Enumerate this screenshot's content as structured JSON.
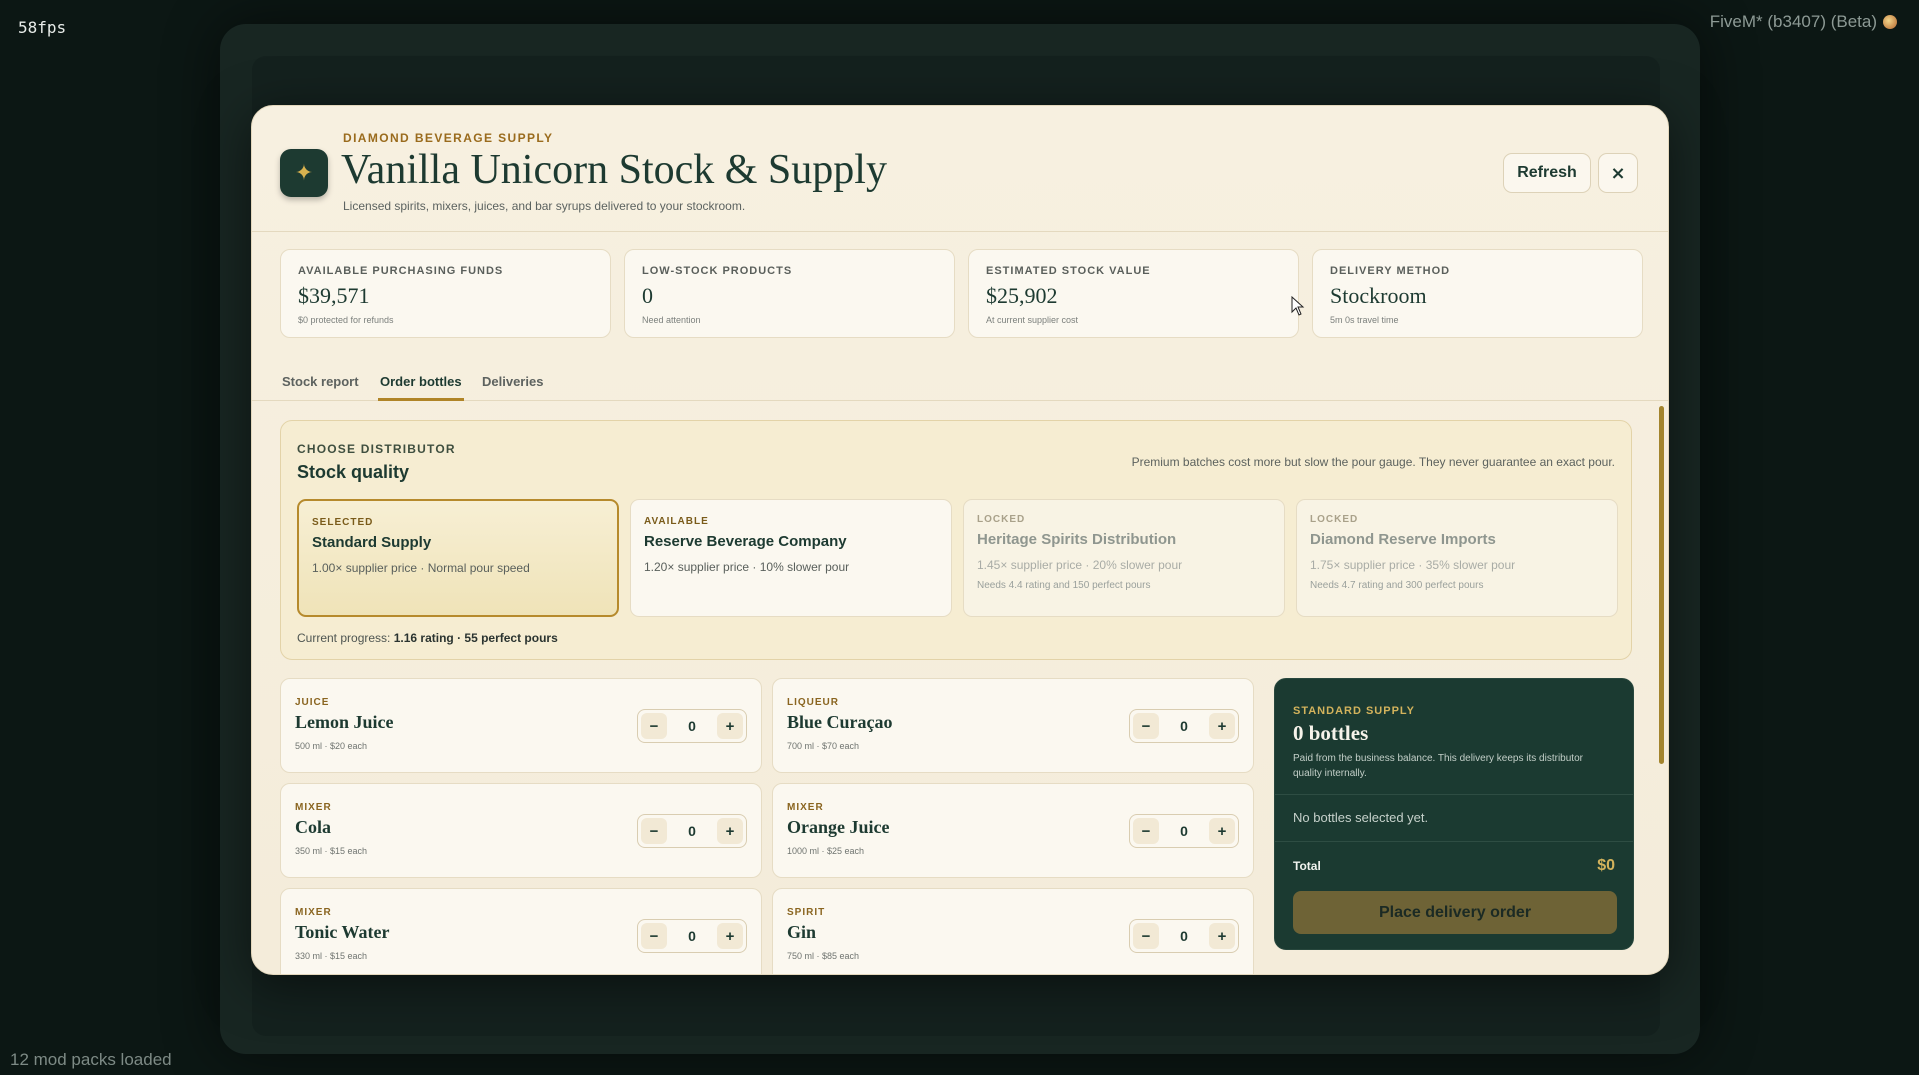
{
  "overlay": {
    "fps": "58fps",
    "client": "FiveM* (b3407) (Beta)",
    "mods": "12 mod packs loaded"
  },
  "header": {
    "eyebrow": "DIAMOND BEVERAGE SUPPLY",
    "title": "Vanilla Unicorn Stock & Supply",
    "subtitle": "Licensed spirits, mixers, juices, and bar syrups delivered to your stockroom.",
    "logo_icon": "sparkle-icon",
    "refresh_label": "Refresh",
    "close_label": "×"
  },
  "stats": [
    {
      "label": "AVAILABLE PURCHASING FUNDS",
      "value": "$39,571",
      "note": "$0 protected for refunds"
    },
    {
      "label": "LOW-STOCK PRODUCTS",
      "value": "0",
      "note": "Need attention"
    },
    {
      "label": "ESTIMATED STOCK VALUE",
      "value": "$25,902",
      "note": "At current supplier cost"
    },
    {
      "label": "DELIVERY METHOD",
      "value": "Stockroom",
      "note": "5m 0s travel time"
    }
  ],
  "tabs": [
    {
      "label": "Stock report",
      "active": false
    },
    {
      "label": "Order bottles",
      "active": true
    },
    {
      "label": "Deliveries",
      "active": false
    }
  ],
  "distributor": {
    "eyebrow": "CHOOSE DISTRIBUTOR",
    "title": "Stock quality",
    "note": "Premium batches cost more but slow the pour gauge. They never guarantee an exact pour.",
    "progress_label": "Current progress:",
    "progress_value": "1.16 rating · 55 perfect pours",
    "tiers": [
      {
        "status": "SELECTED",
        "name": "Standard Supply",
        "desc": "1.00× supplier price · Normal pour speed",
        "need": ""
      },
      {
        "status": "AVAILABLE",
        "name": "Reserve Beverage Company",
        "desc": "1.20× supplier price · 10% slower pour",
        "need": ""
      },
      {
        "status": "LOCKED",
        "name": "Heritage Spirits Distribution",
        "desc": "1.45× supplier price · 20% slower pour",
        "need": "Needs 4.4 rating and 150 perfect pours"
      },
      {
        "status": "LOCKED",
        "name": "Diamond Reserve Imports",
        "desc": "1.75× supplier price · 35% slower pour",
        "need": "Needs 4.7 rating and 300 perfect pours"
      }
    ]
  },
  "products": [
    {
      "category": "JUICE",
      "name": "Lemon Juice",
      "meta": "500 ml · $20 each",
      "qty": "0"
    },
    {
      "category": "LIQUEUR",
      "name": "Blue Curaçao",
      "meta": "700 ml · $70 each",
      "qty": "0"
    },
    {
      "category": "MIXER",
      "name": "Cola",
      "meta": "350 ml · $15 each",
      "qty": "0"
    },
    {
      "category": "MIXER",
      "name": "Orange Juice",
      "meta": "1000 ml · $25 each",
      "qty": "0"
    },
    {
      "category": "MIXER",
      "name": "Tonic Water",
      "meta": "330 ml · $15 each",
      "qty": "0"
    },
    {
      "category": "SPIRIT",
      "name": "Gin",
      "meta": "750 ml · $85 each",
      "qty": "0"
    }
  ],
  "stepper": {
    "minus": "−",
    "plus": "+"
  },
  "summary": {
    "eyebrow": "STANDARD SUPPLY",
    "count": "0 bottles",
    "note": "Paid from the business balance. This delivery keeps its distributor quality internally.",
    "empty": "No bottles selected yet.",
    "total_label": "Total",
    "total_value": "$0",
    "place_label": "Place delivery order"
  }
}
